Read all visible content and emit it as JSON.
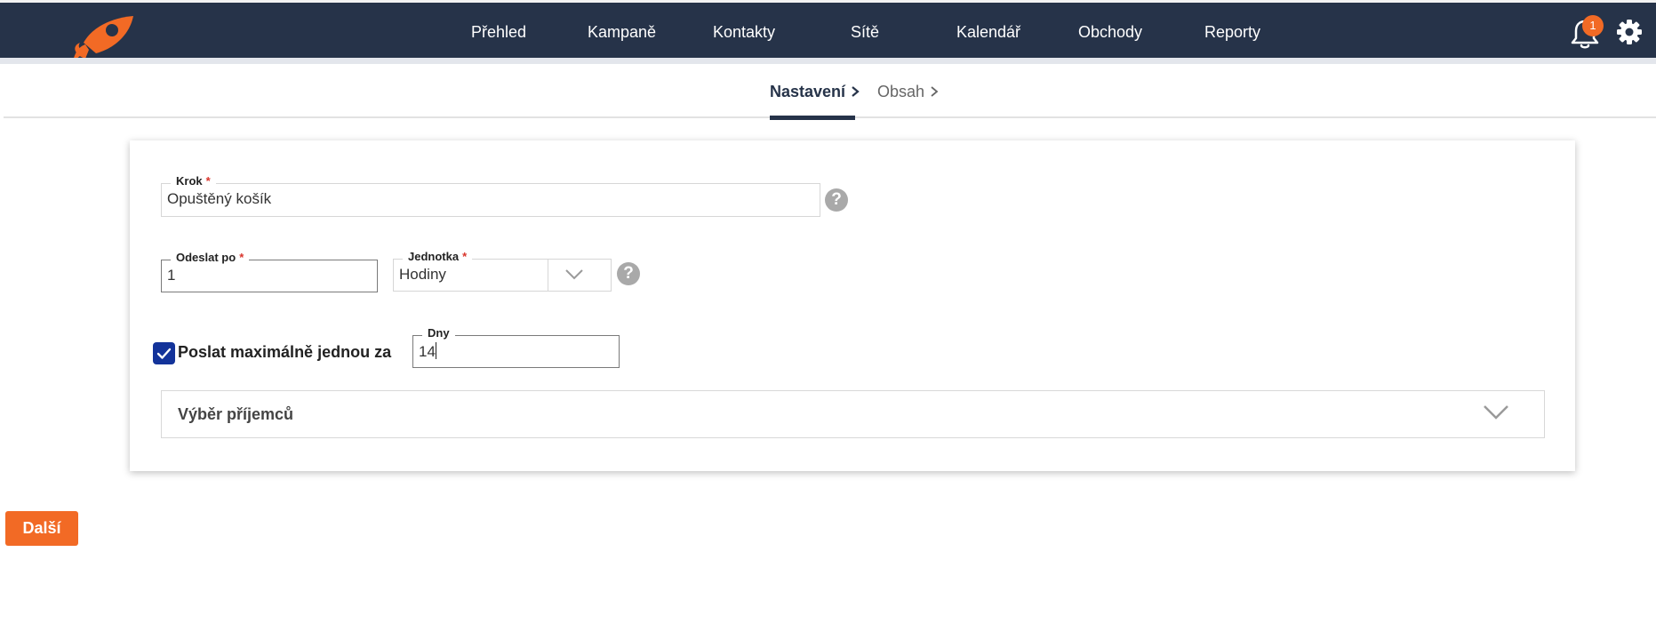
{
  "nav": {
    "items": [
      {
        "label": "Přehled"
      },
      {
        "label": "Kampaně"
      },
      {
        "label": "Kontakty"
      },
      {
        "label": "Sítě"
      },
      {
        "label": "Kalendář"
      },
      {
        "label": "Obchody"
      },
      {
        "label": "Reporty"
      }
    ],
    "notification_count": "1",
    "icons": {
      "logo": "rocket-logo",
      "notifications": "bell-icon",
      "settings": "gear-icon"
    }
  },
  "steps": [
    {
      "label": "Nastavení",
      "active": true
    },
    {
      "label": "Obsah",
      "active": false
    }
  ],
  "form": {
    "step": {
      "label": "Krok",
      "required_mark": "*",
      "value": "Opuštěný košík"
    },
    "send_after": {
      "label": "Odeslat po",
      "required_mark": "*",
      "value": "1"
    },
    "unit": {
      "label": "Jednotka",
      "required_mark": "*",
      "value": "Hodiny"
    },
    "max_once": {
      "label": "Poslat maximálně jednou za",
      "checked": true
    },
    "days": {
      "label": "Dny",
      "value": "14"
    },
    "recipients": {
      "title": "Výběr příjemců",
      "expanded": false
    }
  },
  "actions": {
    "next_label": "Další"
  },
  "colors": {
    "navbar": "#263349",
    "accent": "#f26a25",
    "checkbox": "#13339a",
    "required": "#d9342b"
  }
}
